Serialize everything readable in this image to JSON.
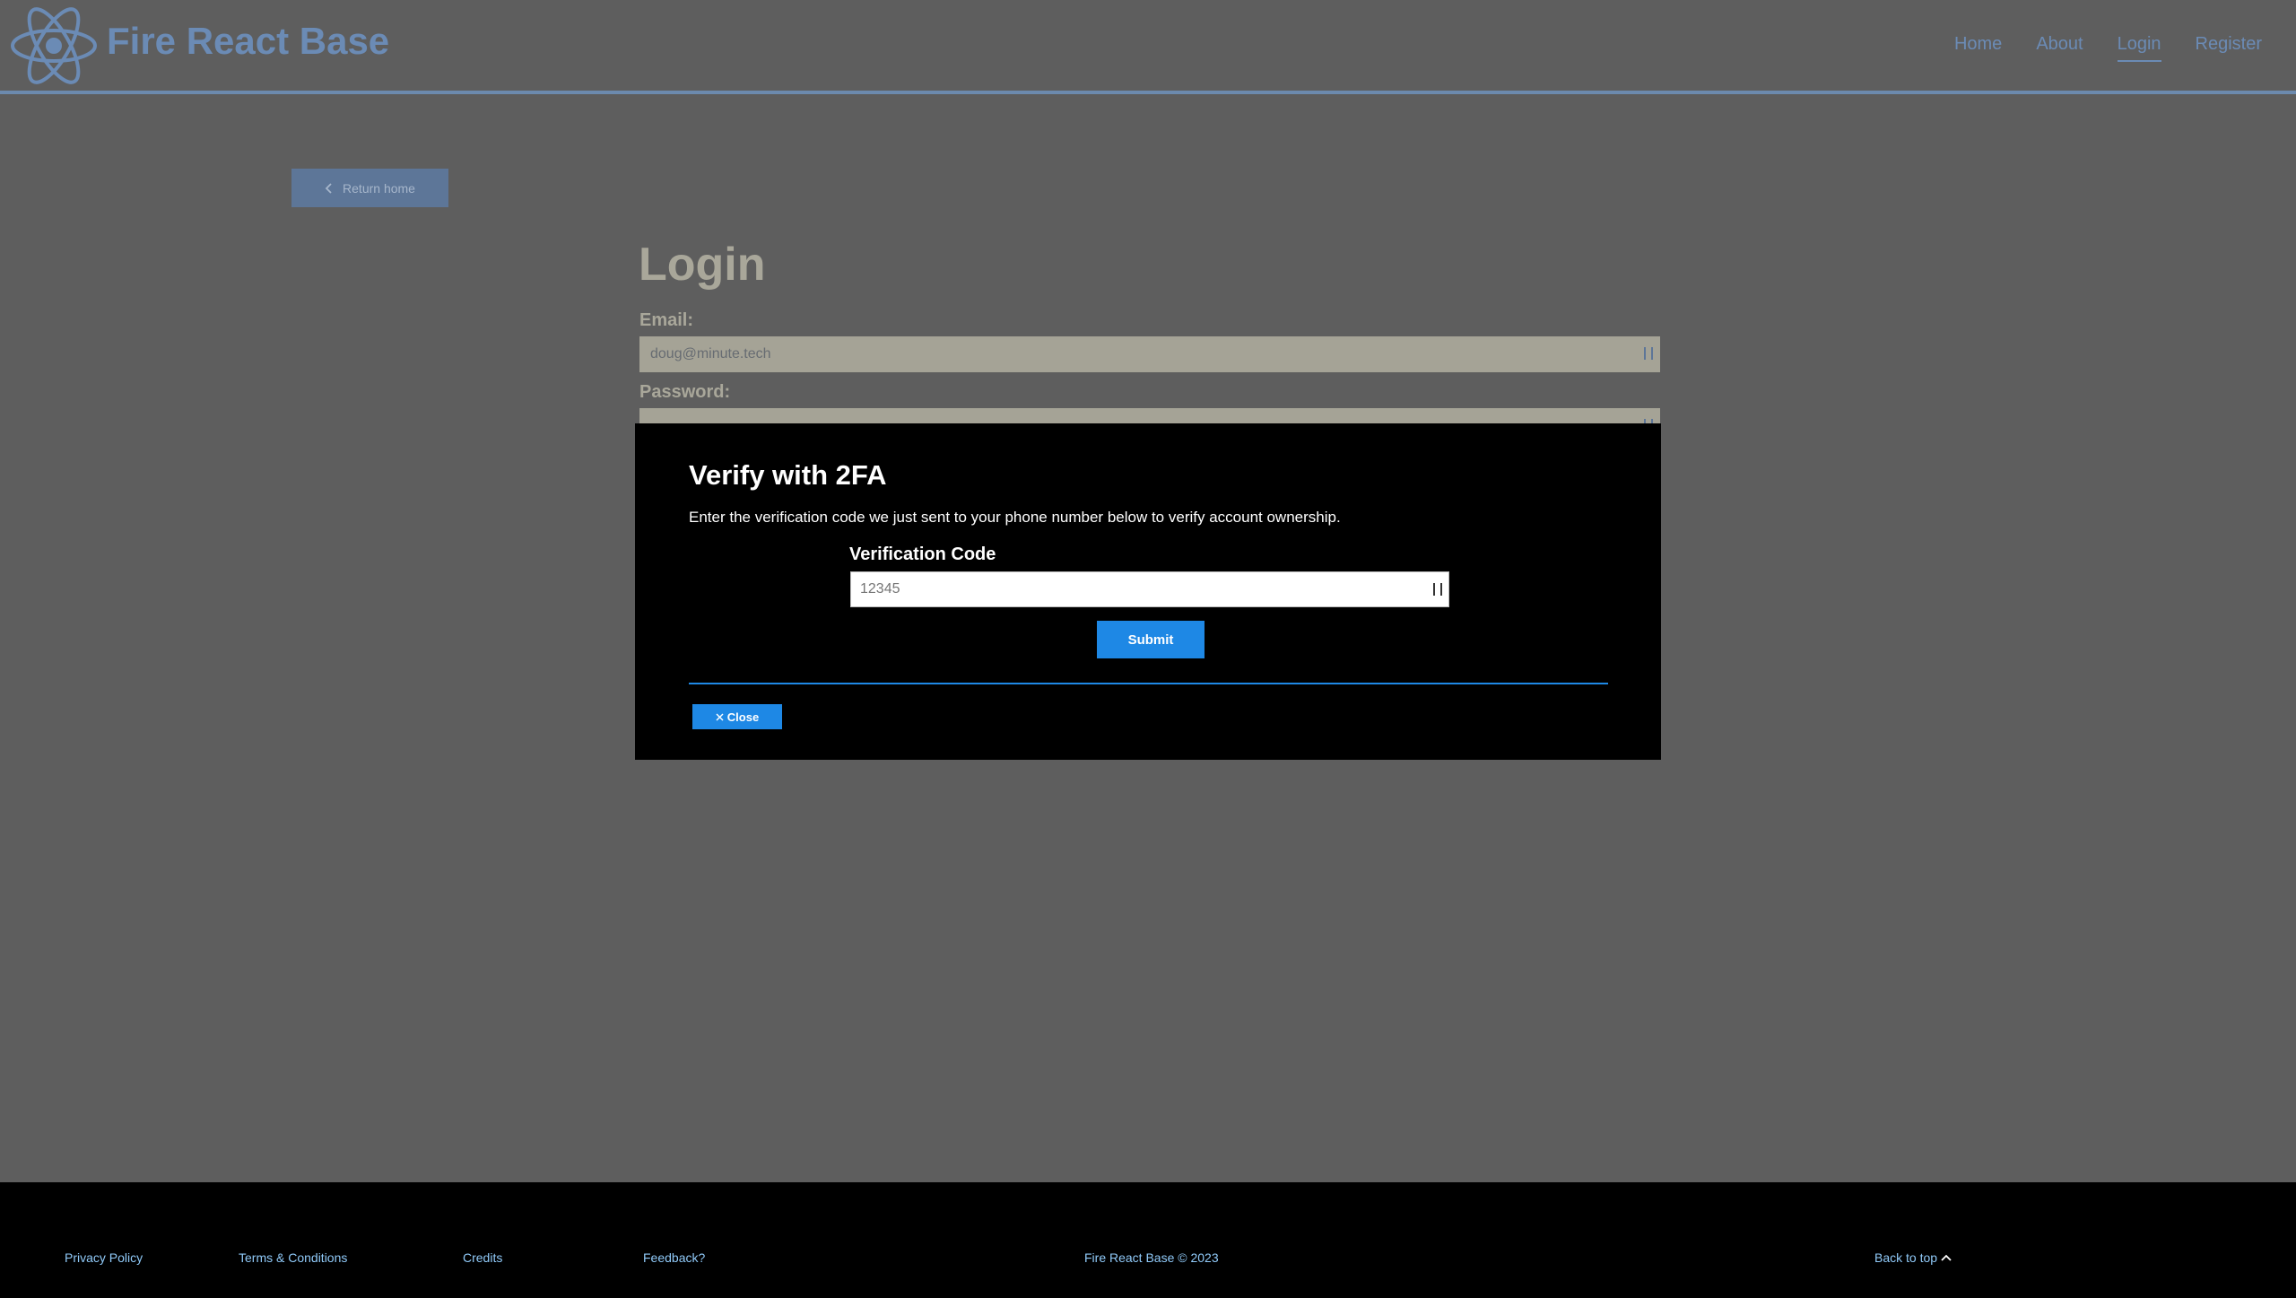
{
  "header": {
    "brand": "Fire React Base",
    "nav": [
      {
        "label": "Home"
      },
      {
        "label": "About"
      },
      {
        "label": "Login",
        "active": true
      },
      {
        "label": "Register"
      }
    ]
  },
  "page": {
    "return_button": "Return home",
    "title": "Login",
    "email_label": "Email:",
    "email_value": "doug@minute.tech",
    "password_label": "Password:"
  },
  "modal": {
    "title": "Verify with 2FA",
    "description": "Enter the verification code we just sent to your phone number below to verify account ownership.",
    "code_label": "Verification Code",
    "code_placeholder": "12345",
    "submit_label": "Submit",
    "close_label": "Close"
  },
  "footer": {
    "privacy": "Privacy Policy",
    "terms": "Terms & Conditions",
    "credits": "Credits",
    "feedback": "Feedback?",
    "copyright": "Fire React Base © 2023",
    "back_to_top": "Back to top"
  },
  "colors": {
    "accent": "#1e88e5",
    "brand_dimmed": "#6b8bb5",
    "overlay_background": "#5e5e5e"
  },
  "icons": [
    "react-logo-icon",
    "chevron-left-icon",
    "close-icon",
    "chevron-up-icon"
  ]
}
